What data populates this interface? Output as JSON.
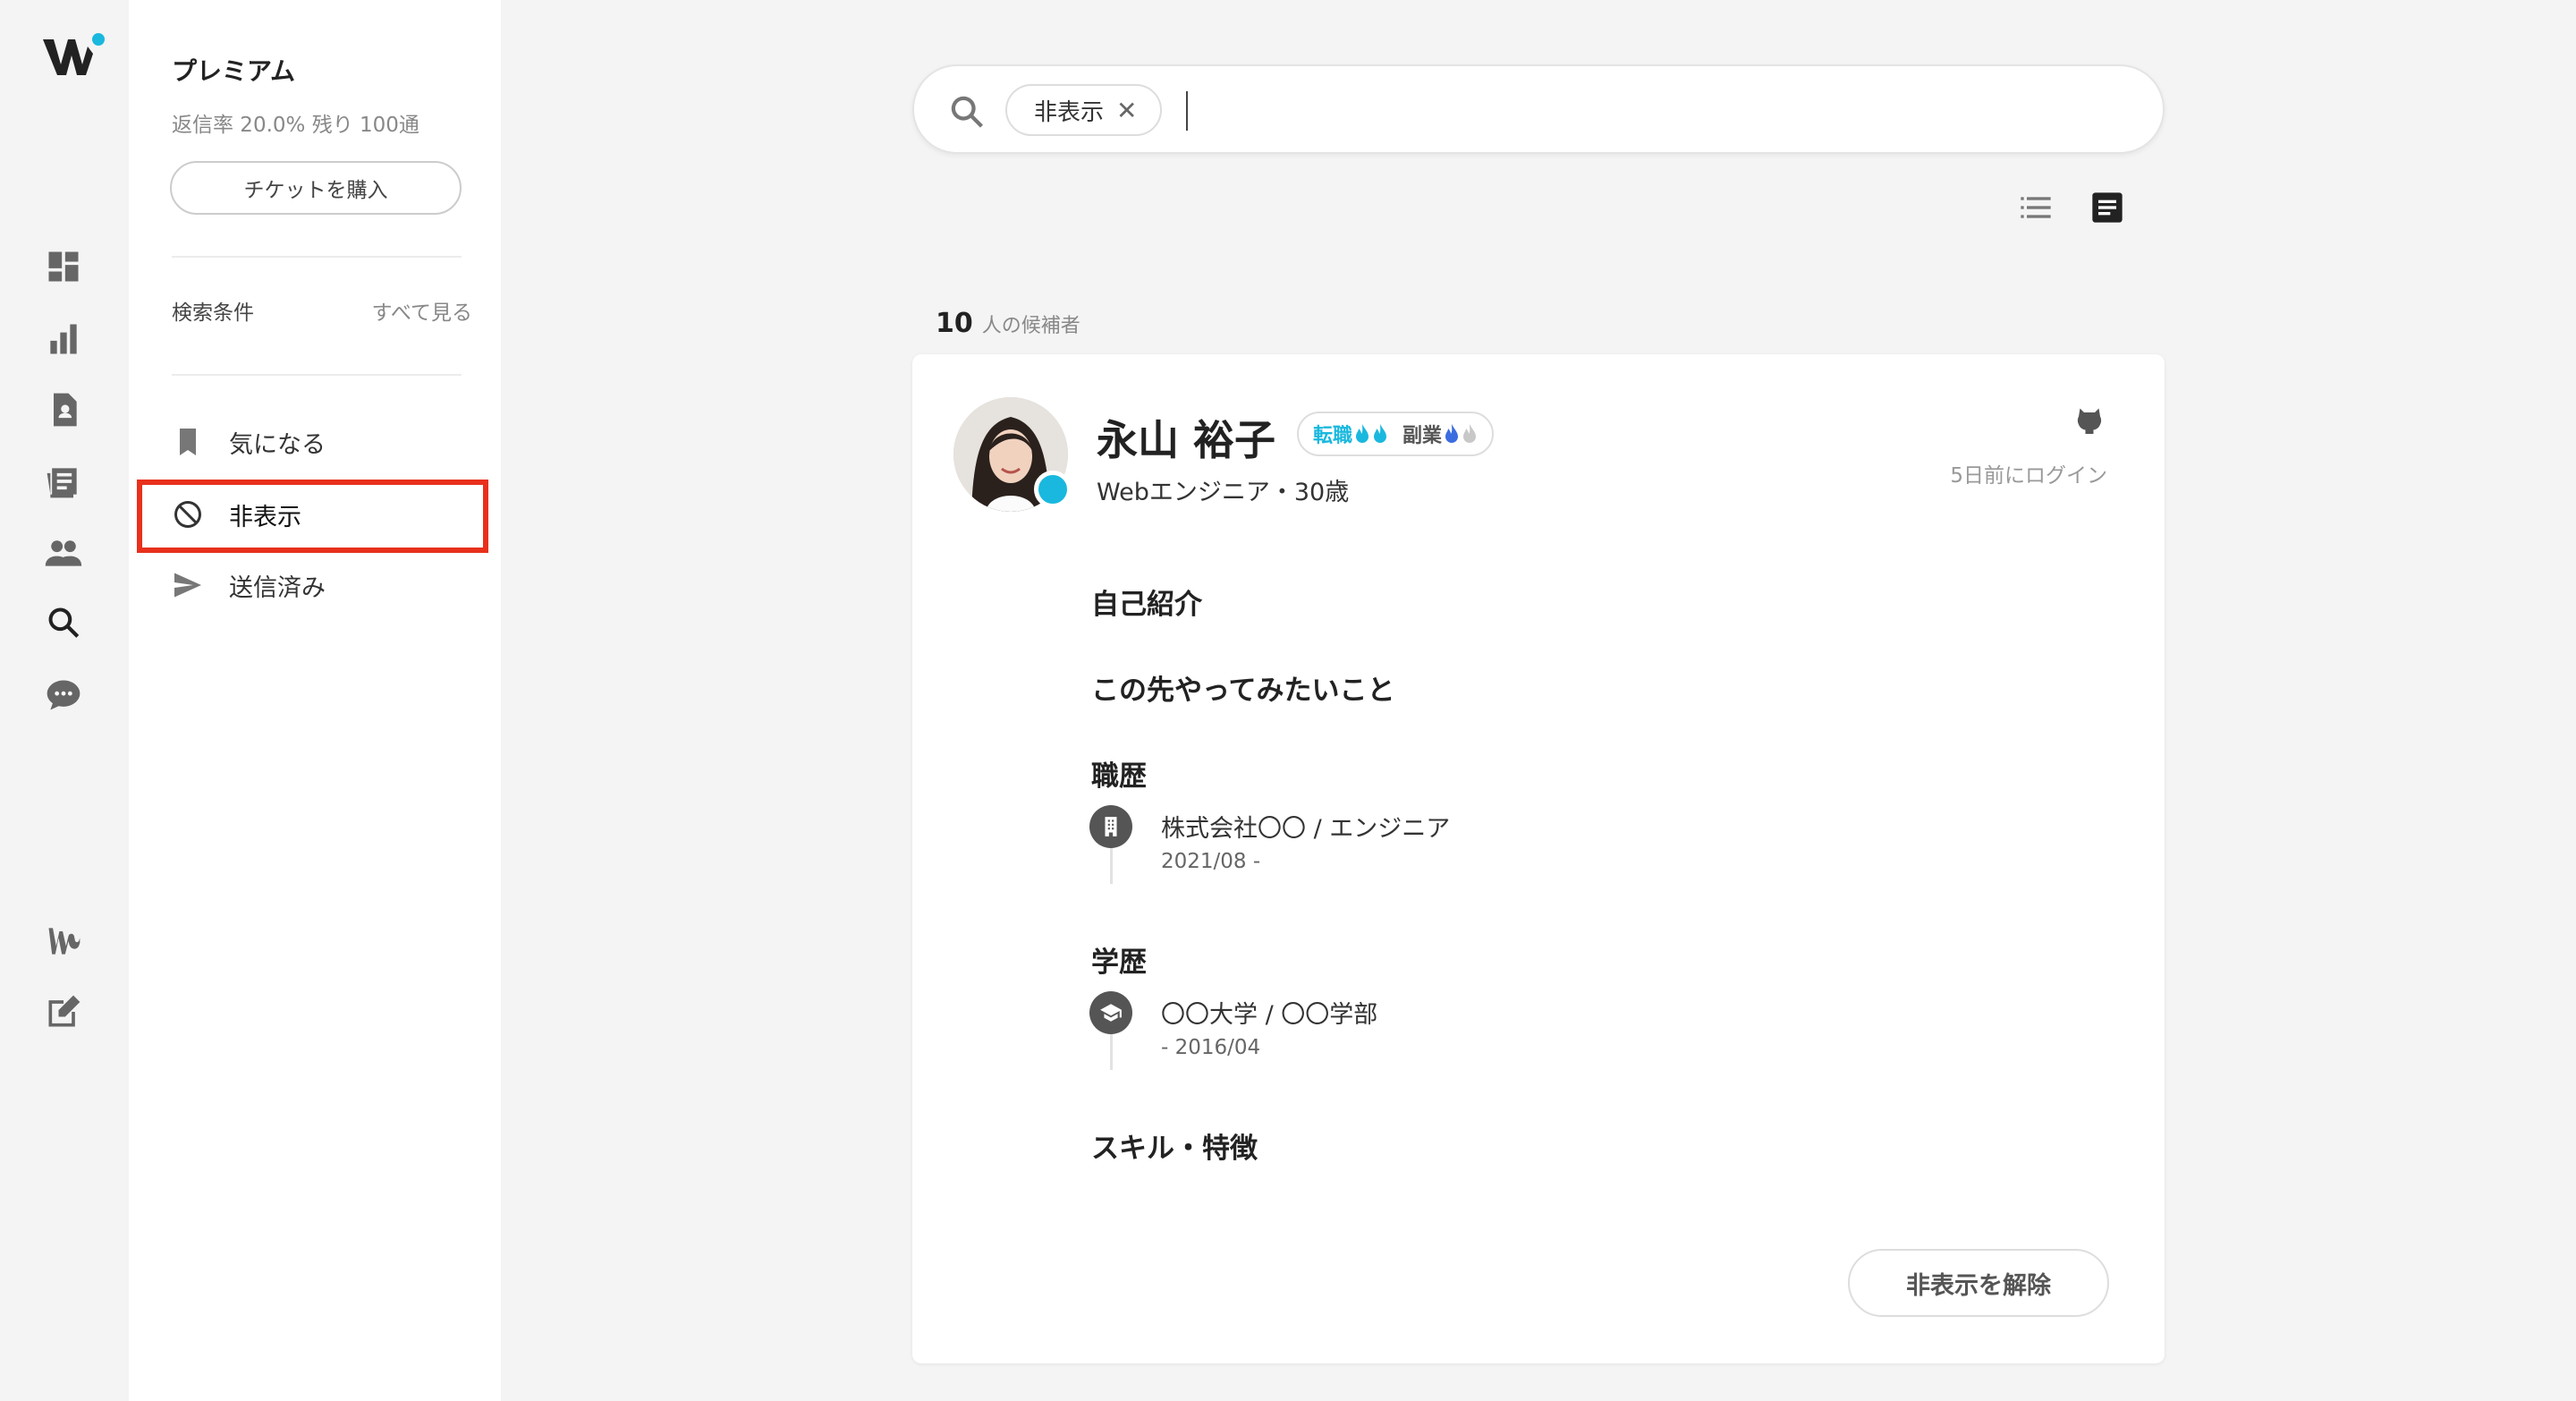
{
  "sidebar": {
    "plan_title": "プレミアム",
    "plan_stats": "返信率 20.0%  残り 100通",
    "ticket_button": "チケットを購入",
    "search_conditions_label": "検索条件",
    "see_all_link": "すべて見る",
    "items": [
      {
        "label": "気になる",
        "icon": "bookmark-icon"
      },
      {
        "label": "非表示",
        "icon": "block-icon"
      },
      {
        "label": "送信済み",
        "icon": "send-icon"
      }
    ]
  },
  "rail": {
    "icons": [
      "dashboard-icon",
      "bar-chart-icon",
      "contact-card-icon",
      "article-icon",
      "people-icon",
      "search-icon",
      "chat-icon",
      "w-brand-icon",
      "edit-icon"
    ]
  },
  "search": {
    "chip_label": "非表示"
  },
  "results": {
    "count": "10",
    "count_suffix": "人の候補者"
  },
  "candidate": {
    "name": "永山 裕子",
    "badge_career": "転職",
    "badge_side": "副業",
    "role": "Webエンジニア・30歳",
    "last_login": "5日前にログイン",
    "sections": {
      "intro": "自己紹介",
      "future": "この先やってみたいこと",
      "work_history": "職歴",
      "education": "学歴",
      "skills": "スキル・特徴"
    },
    "work": {
      "title": "株式会社〇〇 / エンジニア",
      "date": "2021/08 -"
    },
    "school": {
      "title": "〇〇大学 / 〇〇学部",
      "date": "- 2016/04"
    },
    "unhide_button": "非表示を解除"
  },
  "colors": {
    "accent": "#1ab8de",
    "highlight": "#e8301c"
  }
}
